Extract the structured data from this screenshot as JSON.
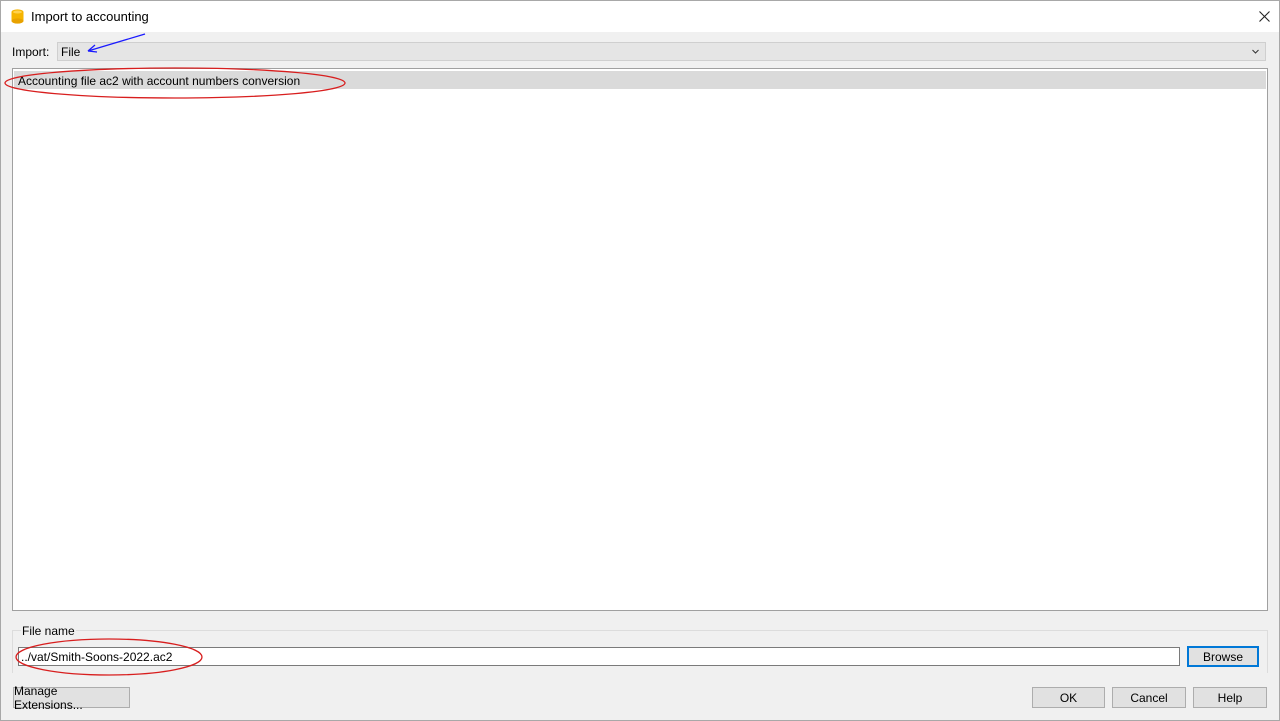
{
  "window": {
    "title": "Import to accounting",
    "icon": "banana-app-icon",
    "close_icon": "close-icon"
  },
  "import": {
    "label": "Import:",
    "selected": "File"
  },
  "list": {
    "items": [
      {
        "label": "Accounting file ac2 with account numbers conversion",
        "selected": true
      }
    ]
  },
  "file_group": {
    "label": "File name",
    "value": "../vat/Smith-Soons-2022.ac2",
    "browse_label": "Browse"
  },
  "buttons": {
    "manage_extensions": "Manage Extensions...",
    "ok": "OK",
    "cancel": "Cancel",
    "help": "Help"
  },
  "colors": {
    "annotation_red": "#d81e1e",
    "annotation_blue": "#1a1aff",
    "default_button_border": "#0078d7",
    "selection": "#dadada"
  }
}
